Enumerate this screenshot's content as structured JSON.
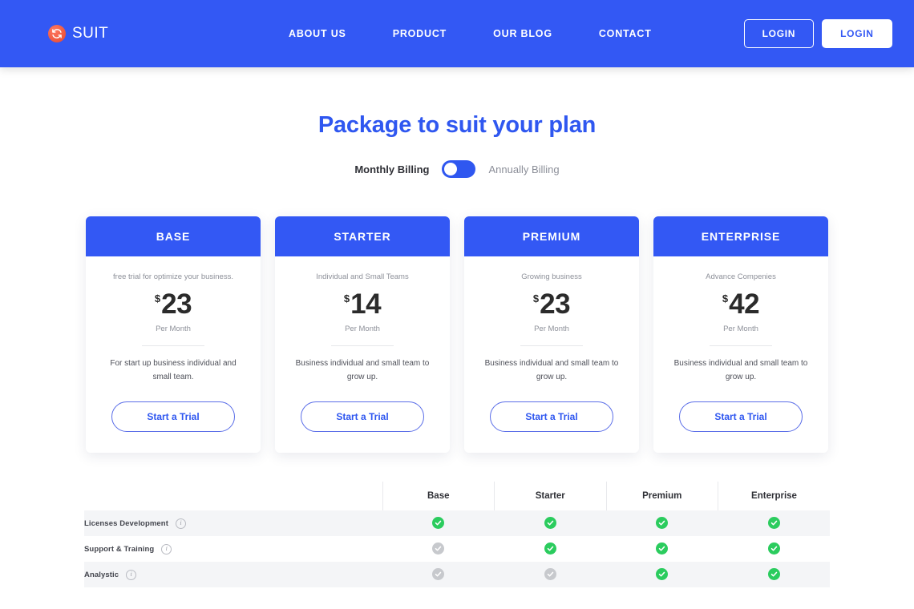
{
  "header": {
    "brand": {
      "name": "SUIT",
      "logo_icon": "refresh-arrows-icon",
      "logo_color": "#f05a41"
    },
    "nav": [
      {
        "label": "ABOUT US"
      },
      {
        "label": "PRODUCT"
      },
      {
        "label": "OUR BLOG"
      },
      {
        "label": "CONTACT"
      }
    ],
    "actions": {
      "login_outline": "LOGIN",
      "login_solid": "LOGIN"
    },
    "background_color": "#3358f4"
  },
  "main": {
    "title": "Package to suit your plan",
    "title_color": "#2f57f0",
    "billing": {
      "monthly_label": "Monthly Billing",
      "annually_label": "Annually Billing",
      "selected": "Monthly Billing",
      "toggle_icon": "toggle-switch-icon"
    },
    "plans": [
      {
        "name": "BASE",
        "tagline": "free trial for optimize your business.",
        "currency": "$",
        "price": "23",
        "period": "Per Month",
        "description": "For start up business individual and small team.",
        "cta": "Start a Trial"
      },
      {
        "name": "STARTER",
        "tagline": "Individual and Small Teams",
        "currency": "$",
        "price": "14",
        "period": "Per Month",
        "description": "Business individual and small team to grow up.",
        "cta": "Start a Trial"
      },
      {
        "name": "PREMIUM",
        "tagline": "Growing business",
        "currency": "$",
        "price": "23",
        "period": "Per Month",
        "description": "Business individual and small team to grow up.",
        "cta": "Start a Trial"
      },
      {
        "name": "ENTERPRISE",
        "tagline": "Advance Compenies",
        "currency": "$",
        "price": "42",
        "period": "Per Month",
        "description": "Business individual and small team to grow up.",
        "cta": "Start a Trial"
      }
    ],
    "comparison": {
      "feature_column_header": "",
      "plan_headers": [
        "Base",
        "Starter",
        "Premium",
        "Enterprise"
      ],
      "info_icon": "info-circle-icon",
      "check_icon": "check-circle-icon",
      "colors": {
        "enabled": "#2bcc5e",
        "disabled": "#c7c9cd"
      },
      "rows": [
        {
          "feature": "Licenses Development",
          "values": [
            true,
            true,
            true,
            true
          ]
        },
        {
          "feature": "Support & Training",
          "values": [
            false,
            true,
            true,
            true
          ]
        },
        {
          "feature": "Analystic",
          "values": [
            false,
            false,
            true,
            true
          ]
        }
      ]
    }
  }
}
